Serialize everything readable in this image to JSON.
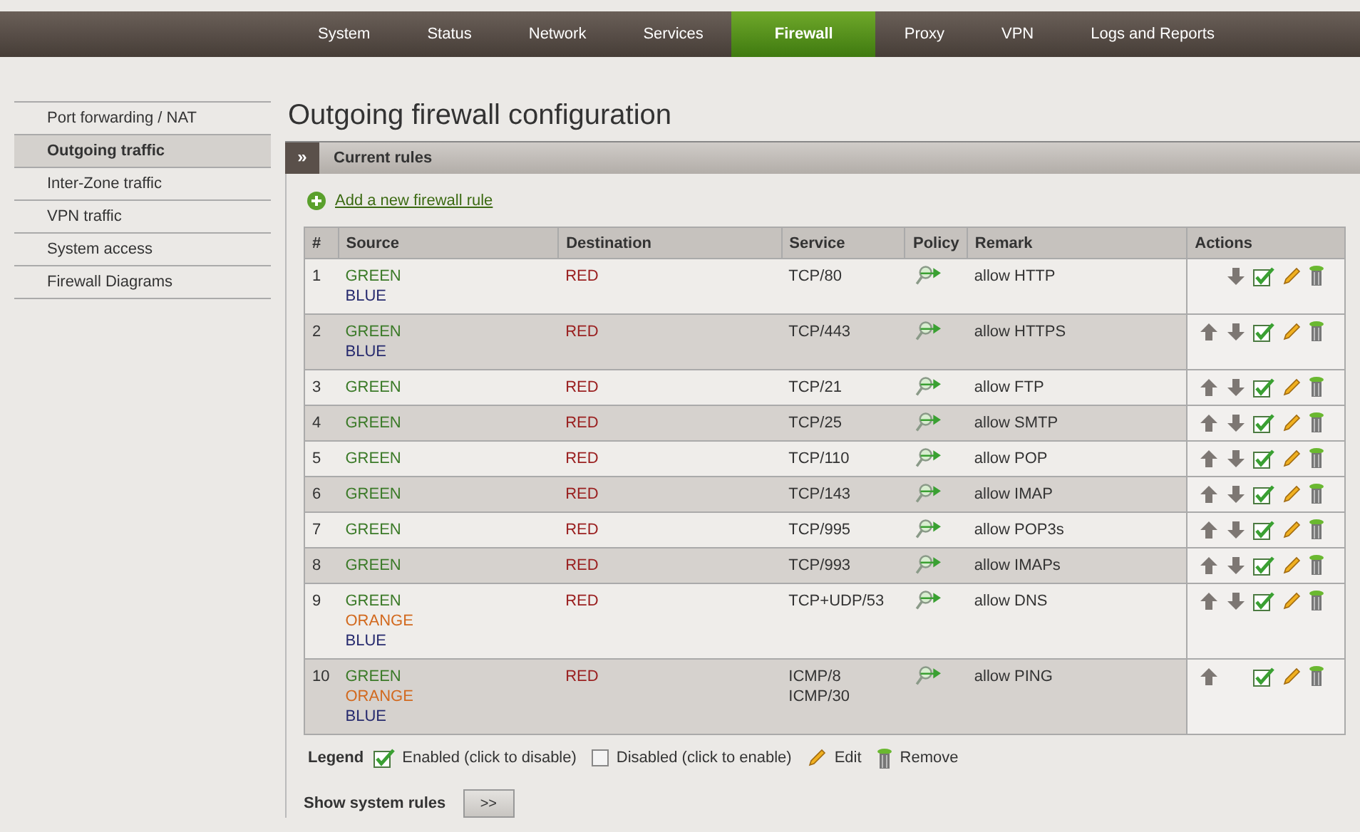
{
  "nav": [
    {
      "label": "System",
      "selected": false
    },
    {
      "label": "Status",
      "selected": false
    },
    {
      "label": "Network",
      "selected": false
    },
    {
      "label": "Services",
      "selected": false
    },
    {
      "label": "Firewall",
      "selected": true
    },
    {
      "label": "Proxy",
      "selected": false
    },
    {
      "label": "VPN",
      "selected": false
    },
    {
      "label": "Logs and Reports",
      "selected": false
    }
  ],
  "sidebar": {
    "items": [
      {
        "label": "Port forwarding / NAT",
        "selected": false
      },
      {
        "label": "Outgoing traffic",
        "selected": true
      },
      {
        "label": "Inter-Zone traffic",
        "selected": false
      },
      {
        "label": "VPN traffic",
        "selected": false
      },
      {
        "label": "System access",
        "selected": false
      },
      {
        "label": "Firewall Diagrams",
        "selected": false
      }
    ]
  },
  "page_title": "Outgoing firewall configuration",
  "panel": {
    "toggle": "»",
    "title": "Current rules"
  },
  "add_link": "Add a new firewall rule",
  "table": {
    "columns": [
      "#",
      "Source",
      "Destination",
      "Service",
      "Policy",
      "Remark",
      "Actions"
    ],
    "rows": [
      {
        "num": "1",
        "source": [
          {
            "name": "GREEN",
            "color": "#3b7a28"
          },
          {
            "name": "BLUE",
            "color": "#262a6e"
          }
        ],
        "destination": [
          {
            "name": "RED",
            "color": "#9a2020"
          }
        ],
        "service": [
          "TCP/80"
        ],
        "kind": "allow",
        "remark": "allow HTTP",
        "move_up": false,
        "move_down": true,
        "enabled": true
      },
      {
        "num": "2",
        "source": [
          {
            "name": "GREEN",
            "color": "#3b7a28"
          },
          {
            "name": "BLUE",
            "color": "#262a6e"
          }
        ],
        "destination": [
          {
            "name": "RED",
            "color": "#9a2020"
          }
        ],
        "service": [
          "TCP/443"
        ],
        "kind": "allow",
        "remark": "allow HTTPS",
        "move_up": true,
        "move_down": true,
        "enabled": true
      },
      {
        "num": "3",
        "source": [
          {
            "name": "GREEN",
            "color": "#3b7a28"
          }
        ],
        "destination": [
          {
            "name": "RED",
            "color": "#9a2020"
          }
        ],
        "service": [
          "TCP/21"
        ],
        "kind": "allow",
        "remark": "allow FTP",
        "move_up": true,
        "move_down": true,
        "enabled": true
      },
      {
        "num": "4",
        "source": [
          {
            "name": "GREEN",
            "color": "#3b7a28"
          }
        ],
        "destination": [
          {
            "name": "RED",
            "color": "#9a2020"
          }
        ],
        "service": [
          "TCP/25"
        ],
        "kind": "allow",
        "remark": "allow SMTP",
        "move_up": true,
        "move_down": true,
        "enabled": true
      },
      {
        "num": "5",
        "source": [
          {
            "name": "GREEN",
            "color": "#3b7a28"
          }
        ],
        "destination": [
          {
            "name": "RED",
            "color": "#9a2020"
          }
        ],
        "service": [
          "TCP/110"
        ],
        "kind": "allow",
        "remark": "allow POP",
        "move_up": true,
        "move_down": true,
        "enabled": true
      },
      {
        "num": "6",
        "source": [
          {
            "name": "GREEN",
            "color": "#3b7a28"
          }
        ],
        "destination": [
          {
            "name": "RED",
            "color": "#9a2020"
          }
        ],
        "service": [
          "TCP/143"
        ],
        "kind": "allow",
        "remark": "allow IMAP",
        "move_up": true,
        "move_down": true,
        "enabled": true
      },
      {
        "num": "7",
        "source": [
          {
            "name": "GREEN",
            "color": "#3b7a28"
          }
        ],
        "destination": [
          {
            "name": "RED",
            "color": "#9a2020"
          }
        ],
        "service": [
          "TCP/995"
        ],
        "kind": "allow",
        "remark": "allow POP3s",
        "move_up": true,
        "move_down": true,
        "enabled": true
      },
      {
        "num": "8",
        "source": [
          {
            "name": "GREEN",
            "color": "#3b7a28"
          }
        ],
        "destination": [
          {
            "name": "RED",
            "color": "#9a2020"
          }
        ],
        "service": [
          "TCP/993"
        ],
        "kind": "allow",
        "remark": "allow IMAPs",
        "move_up": true,
        "move_down": true,
        "enabled": true
      },
      {
        "num": "9",
        "source": [
          {
            "name": "GREEN",
            "color": "#3b7a28"
          },
          {
            "name": "ORANGE",
            "color": "#d2691e"
          },
          {
            "name": "BLUE",
            "color": "#262a6e"
          }
        ],
        "destination": [
          {
            "name": "RED",
            "color": "#9a2020"
          }
        ],
        "service": [
          "TCP+UDP/53"
        ],
        "kind": "allow",
        "remark": "allow DNS",
        "move_up": true,
        "move_down": true,
        "enabled": true
      },
      {
        "num": "10",
        "source": [
          {
            "name": "GREEN",
            "color": "#3b7a28"
          },
          {
            "name": "ORANGE",
            "color": "#d2691e"
          },
          {
            "name": "BLUE",
            "color": "#262a6e"
          }
        ],
        "destination": [
          {
            "name": "RED",
            "color": "#9a2020"
          }
        ],
        "service": [
          "ICMP/8",
          "ICMP/30"
        ],
        "kind": "allow",
        "remark": "allow PING",
        "move_up": true,
        "move_down": false,
        "enabled": true
      }
    ]
  },
  "legend": {
    "title": "Legend",
    "items": [
      {
        "kind": "enabled",
        "label": "Enabled (click to disable)"
      },
      {
        "kind": "disabled",
        "label": "Disabled (click to enable)"
      },
      {
        "kind": "edit",
        "label": "Edit"
      },
      {
        "kind": "remove",
        "label": "Remove"
      }
    ]
  },
  "system_rules": {
    "label": "Show system rules",
    "button": ">>"
  }
}
